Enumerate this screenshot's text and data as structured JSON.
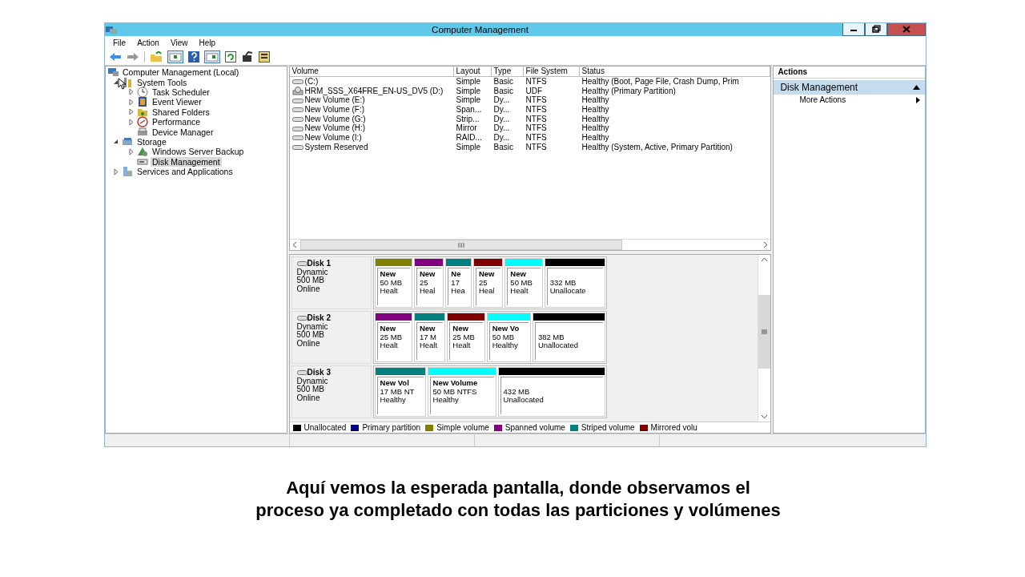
{
  "window": {
    "title": "Computer Management"
  },
  "menu": [
    "File",
    "Action",
    "View",
    "Help"
  ],
  "tree": [
    {
      "label": "Computer Management (Local)",
      "kind": "root",
      "selected": false,
      "children": [
        {
          "label": "System Tools",
          "kind": "branch",
          "expanded": true,
          "selected": false,
          "children": [
            {
              "label": "Task Scheduler",
              "kind": "branch",
              "expanded": false,
              "selected": false
            },
            {
              "label": "Event Viewer",
              "kind": "branch",
              "expanded": false,
              "selected": false
            },
            {
              "label": "Shared Folders",
              "kind": "branch",
              "expanded": false,
              "selected": false
            },
            {
              "label": "Performance",
              "kind": "branch",
              "expanded": false,
              "selected": false
            },
            {
              "label": "Device Manager",
              "kind": "leaf",
              "selected": false
            }
          ]
        },
        {
          "label": "Storage",
          "kind": "branch",
          "expanded": true,
          "selected": false,
          "children": [
            {
              "label": "Windows Server Backup",
              "kind": "branch",
              "expanded": false,
              "selected": false
            },
            {
              "label": "Disk Management",
              "kind": "leaf",
              "selected": true
            }
          ]
        },
        {
          "label": "Services and Applications",
          "kind": "branch",
          "expanded": false,
          "selected": false
        }
      ]
    }
  ],
  "volumes": {
    "columns": [
      "Volume",
      "Layout",
      "Type",
      "File System",
      "Status"
    ],
    "rows": [
      {
        "kind": "disk",
        "cells": [
          "(C:)",
          "Simple",
          "Basic",
          "NTFS",
          "Healthy (Boot, Page File, Crash Dump, Prim"
        ]
      },
      {
        "kind": "optical",
        "cells": [
          "HRM_SSS_X64FRE_EN-US_DV5 (D:)",
          "Simple",
          "Basic",
          "UDF",
          "Healthy (Primary Partition)"
        ]
      },
      {
        "kind": "disk",
        "cells": [
          "New Volume (E:)",
          "Simple",
          "Dy...",
          "NTFS",
          "Healthy"
        ]
      },
      {
        "kind": "disk",
        "cells": [
          "New Volume (F:)",
          "Span...",
          "Dy...",
          "NTFS",
          "Healthy"
        ]
      },
      {
        "kind": "disk",
        "cells": [
          "New Volume (G:)",
          "Strip...",
          "Dy...",
          "NTFS",
          "Healthy"
        ]
      },
      {
        "kind": "disk",
        "cells": [
          "New Volume (H:)",
          "Mirror",
          "Dy...",
          "NTFS",
          "Healthy"
        ]
      },
      {
        "kind": "disk",
        "cells": [
          "New Volume (I:)",
          "RAID...",
          "Dy...",
          "NTFS",
          "Healthy"
        ]
      },
      {
        "kind": "disk",
        "cells": [
          "System Reserved",
          "Simple",
          "Basic",
          "NTFS",
          "Healthy (System, Active, Primary Partition)"
        ]
      }
    ]
  },
  "disks": [
    {
      "name": "Disk 1",
      "type": "Dynamic",
      "size": "500 MB",
      "status": "Online",
      "partitions": [
        {
          "color": "#808000",
          "title": "New",
          "lines": [
            "50 MB",
            "Healt"
          ]
        },
        {
          "color": "#800080",
          "title": "New",
          "lines": [
            "25",
            "Heal"
          ]
        },
        {
          "color": "#008080",
          "title": "Ne",
          "lines": [
            "17",
            "Hea"
          ]
        },
        {
          "color": "#800000",
          "title": "New",
          "lines": [
            "25",
            "Heal"
          ]
        },
        {
          "color": "#00ffff",
          "title": "New",
          "lines": [
            "50 MB",
            "Healt"
          ]
        },
        {
          "color": "#000000",
          "lines": [
            "332 MB",
            "Unallocate"
          ]
        }
      ]
    },
    {
      "name": "Disk 2",
      "type": "Dynamic",
      "size": "500 MB",
      "status": "Online",
      "partitions": [
        {
          "color": "#800080",
          "title": "New",
          "lines": [
            "25 MB",
            "Healt"
          ]
        },
        {
          "color": "#008080",
          "title": "New",
          "lines": [
            "17 M",
            "Healt"
          ]
        },
        {
          "color": "#800000",
          "title": "New",
          "lines": [
            "25 MB",
            "Healt"
          ]
        },
        {
          "color": "#00ffff",
          "title": "New Vo",
          "lines": [
            "50 MB",
            "Healthy"
          ]
        },
        {
          "color": "#000000",
          "lines": [
            "382 MB",
            "Unallocated"
          ]
        }
      ]
    },
    {
      "name": "Disk 3",
      "type": "Dynamic",
      "size": "500 MB",
      "status": "Online",
      "partitions": [
        {
          "color": "#008080",
          "title": "New Vol",
          "lines": [
            "17 MB NT",
            "Healthy"
          ]
        },
        {
          "color": "#00ffff",
          "title": "New Volume",
          "lines": [
            "50 MB NTFS",
            "Healthy"
          ]
        },
        {
          "color": "#000000",
          "lines": [
            "432 MB",
            "Unallocated"
          ]
        }
      ]
    }
  ],
  "legend": [
    {
      "label": "Unallocated",
      "color": "#000000"
    },
    {
      "label": "Primary partition",
      "color": "#000080"
    },
    {
      "label": "Simple volume",
      "color": "#808000"
    },
    {
      "label": "Spanned volume",
      "color": "#800080"
    },
    {
      "label": "Striped volume",
      "color": "#008080"
    },
    {
      "label": "Mirrored volu",
      "color": "#800000"
    }
  ],
  "actions": {
    "header": "Actions",
    "section": "Disk Management",
    "items": [
      "More Actions"
    ]
  },
  "caption": [
    "Aquí vemos la esperada pantalla, donde observamos el",
    "proceso ya completado con todas las particiones y volúmenes"
  ]
}
